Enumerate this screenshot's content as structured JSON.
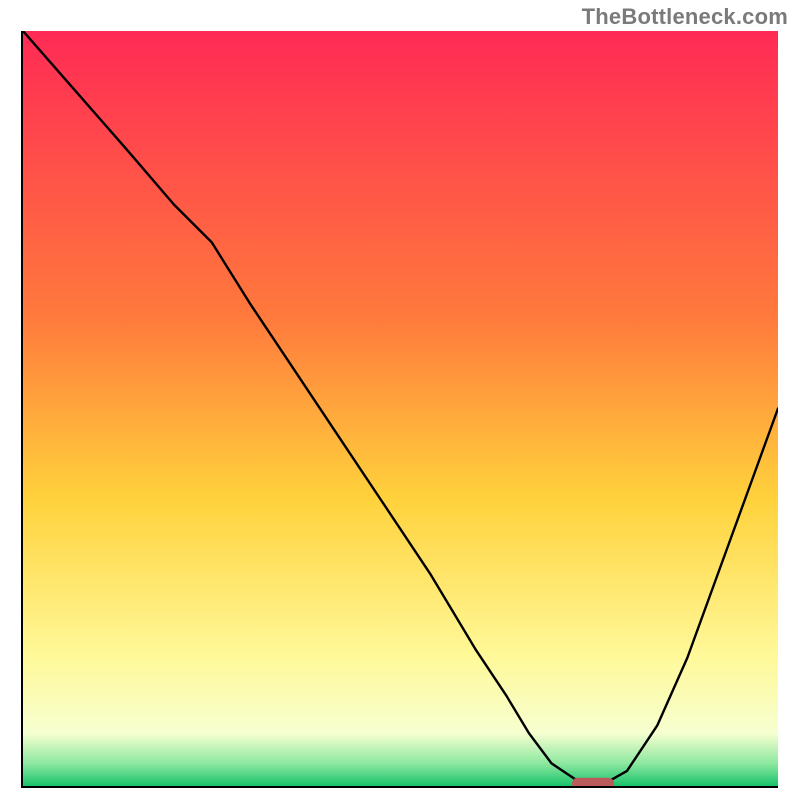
{
  "watermark": "TheBottleneck.com",
  "gradient_stops": [
    {
      "offset": "0%",
      "color": "#ff2a55"
    },
    {
      "offset": "38%",
      "color": "#ff7a3c"
    },
    {
      "offset": "62%",
      "color": "#ffd23c"
    },
    {
      "offset": "83%",
      "color": "#fff99a"
    },
    {
      "offset": "93%",
      "color": "#f6ffd0"
    },
    {
      "offset": "97%",
      "color": "#8de8a0"
    },
    {
      "offset": "100%",
      "color": "#18c36b"
    }
  ],
  "chart_data": {
    "type": "line",
    "title": "",
    "xlabel": "",
    "ylabel": "",
    "xlim": [
      0,
      100
    ],
    "ylim": [
      0,
      100
    ],
    "x": [
      0,
      7,
      14,
      20,
      25,
      30,
      36,
      42,
      48,
      54,
      60,
      64,
      67,
      70,
      73,
      74,
      75,
      77,
      80,
      84,
      88,
      92,
      96,
      100
    ],
    "values": [
      100,
      92,
      84,
      77,
      72,
      64,
      55,
      46,
      37,
      28,
      18,
      12,
      7,
      3,
      1,
      0.3,
      0.3,
      0.3,
      2,
      8,
      17,
      28,
      39,
      50
    ],
    "optimum_marker": {
      "x_start": 73.5,
      "x_end": 77.5,
      "y": 0.3
    }
  }
}
